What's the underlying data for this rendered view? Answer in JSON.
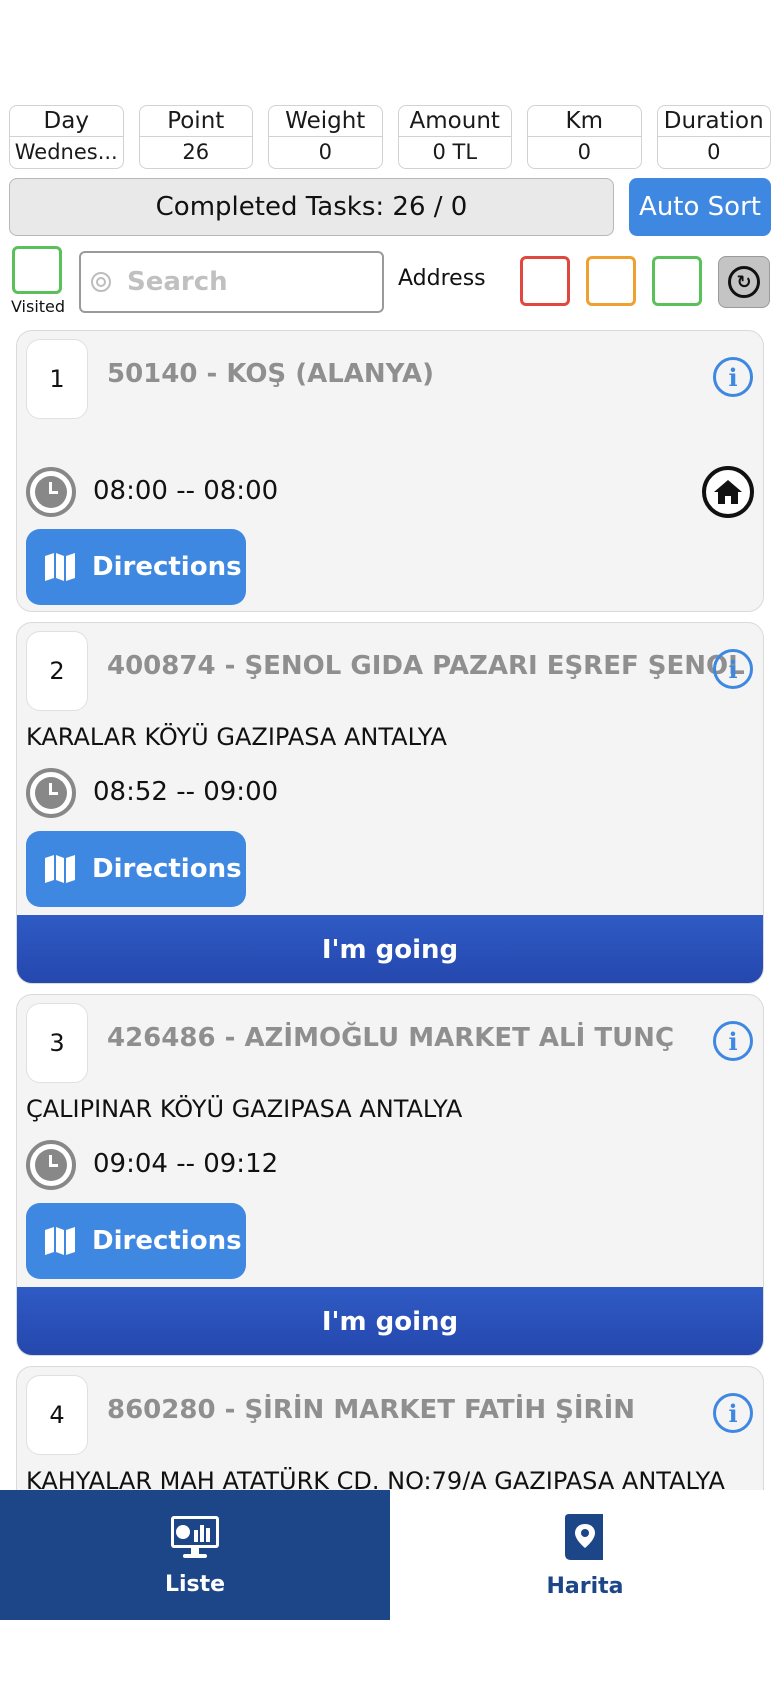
{
  "stats": [
    {
      "label": "Day",
      "value": "Wednes..."
    },
    {
      "label": "Point",
      "value": "26"
    },
    {
      "label": "Weight",
      "value": "0"
    },
    {
      "label": "Amount",
      "value": "0 TL"
    },
    {
      "label": "Km",
      "value": "0"
    },
    {
      "label": "Duration",
      "value": "0"
    }
  ],
  "completed_tasks": "Completed Tasks: 26 / 0",
  "auto_sort_label": "Auto Sort",
  "filters": {
    "visited_label": "Visited",
    "search_placeholder": "Search",
    "address_label": "Address",
    "colors": {
      "red": "#e0483d",
      "orange": "#f0a030",
      "green": "#5ac05a"
    }
  },
  "tasks": [
    {
      "number": "1",
      "title": "50140 - KOŞ (ALANYA)",
      "address": "",
      "time": "08:00 -- 08:00",
      "directions_label": "Directions",
      "home_icon": "home-icon"
    },
    {
      "number": "2",
      "title": "400874 - ŞENOL GIDA PAZARI EŞREF ŞENOL",
      "address": " KARALAR KÖYÜ GAZIPASA ANTALYA",
      "time": "08:52 -- 09:00",
      "directions_label": "Directions",
      "going_label": "I'm going"
    },
    {
      "number": "3",
      "title": "426486 - AZİMOĞLU MARKET ALİ TUNÇ",
      "address": "ÇALIPINAR KÖYÜ GAZIPASA ANTALYA",
      "time": "09:04 -- 09:12",
      "directions_label": "Directions",
      "going_label": "I'm going"
    },
    {
      "number": "4",
      "title": "860280 - ŞİRİN MARKET FATİH ŞİRİN",
      "address": "KAHYALAR MAH ATATÜRK CD. NO:79/A GAZIPASA ANTALYA"
    }
  ],
  "bottom_nav": [
    {
      "label": "Liste",
      "icon": "monitor-chart-icon",
      "active": true
    },
    {
      "label": "Harita",
      "icon": "map-pin-book-icon",
      "active": false
    }
  ],
  "accent_color": "#3f88e2",
  "nav_color": "#1c4687"
}
